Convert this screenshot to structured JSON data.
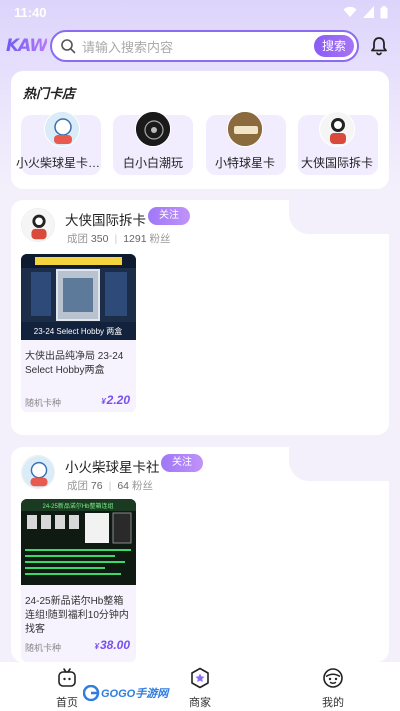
{
  "status_bar": {
    "time": "11:40"
  },
  "header": {
    "logo_text": "KAW",
    "search_placeholder": "请输入搜索内容",
    "search_button": "搜索"
  },
  "hot_shops": {
    "title": "热门卡店",
    "shops": [
      {
        "name": "小火柴球星卡官方店"
      },
      {
        "name": "白小白潮玩"
      },
      {
        "name": "小特球星卡"
      },
      {
        "name": "大侠国际拆卡"
      }
    ]
  },
  "stores": [
    {
      "name": "大侠国际拆卡",
      "follow_label": "关注",
      "deals_label": "成团",
      "deals_count": "350",
      "fans_count": "1291",
      "fans_label": "粉丝",
      "product": {
        "image_caption": "23-24 Select Hobby 两盒",
        "title": "大侠出品纯净局 23-24 Select Hobby两盒",
        "tag": "随机卡种",
        "price_symbol": "¥",
        "price": "2.20"
      }
    },
    {
      "name": "小火柴球星卡社",
      "follow_label": "关注",
      "deals_label": "成团",
      "deals_count": "76",
      "fans_count": "64",
      "fans_label": "粉丝",
      "product": {
        "image_caption": "24-25新品诺尔Hb整箱连组",
        "title": "24-25新品诺尔Hb整箱连组!随到福利10分钟内找客",
        "tag": "随机卡种",
        "price_symbol": "¥",
        "price": "38.00"
      }
    }
  ],
  "bottom_nav": {
    "items": [
      {
        "label": "首页",
        "icon": "home-icon"
      },
      {
        "label": "商家",
        "icon": "store-icon"
      },
      {
        "label": "我的",
        "icon": "profile-icon"
      }
    ],
    "active": "商家"
  },
  "watermark": {
    "text": "GOGO手游网"
  },
  "colors": {
    "accent": "#8a6cf3",
    "price": "#7a4ff0",
    "background": "#f3f0fb"
  }
}
